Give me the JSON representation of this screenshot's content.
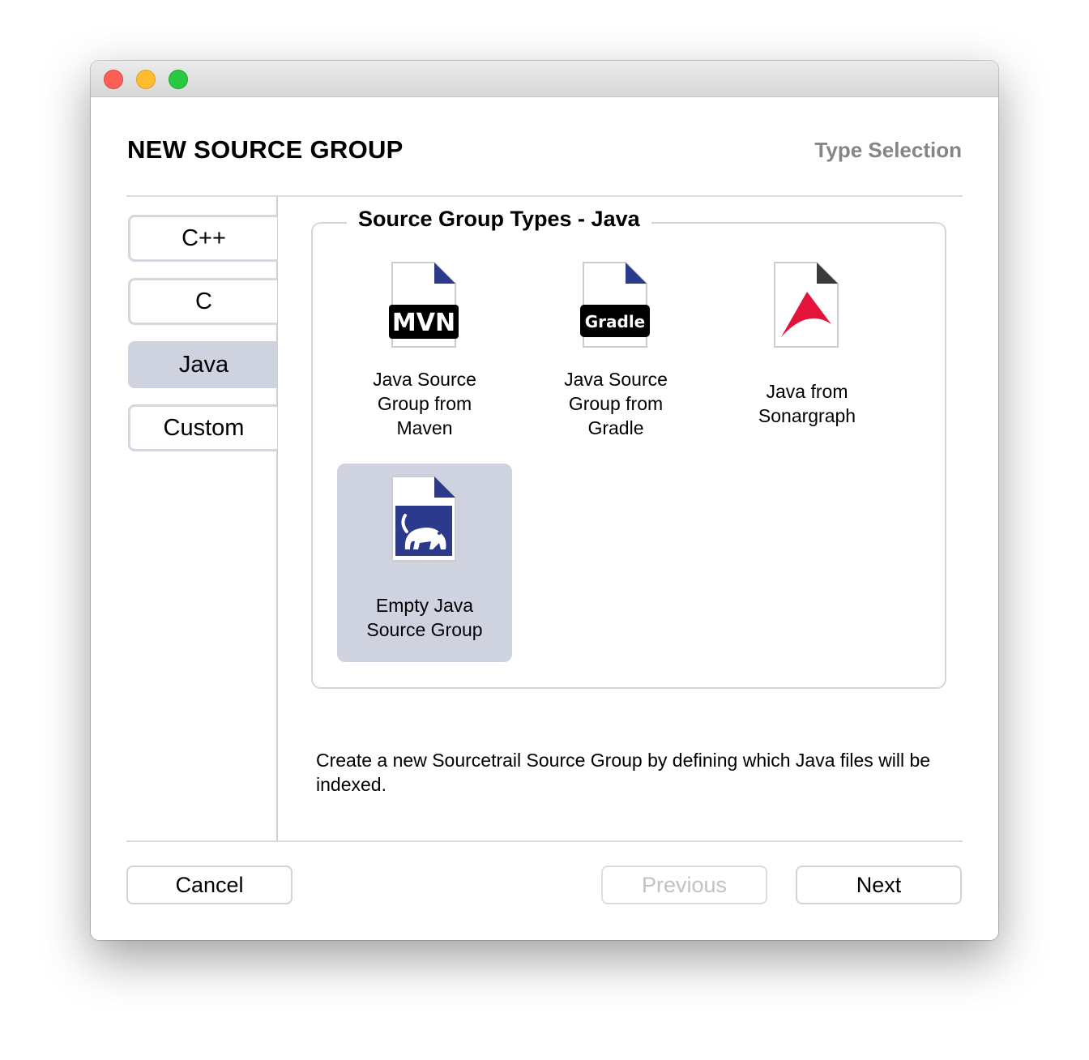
{
  "window": {
    "traffic_lights": [
      "close",
      "minimize",
      "zoom"
    ]
  },
  "header": {
    "title": "NEW SOURCE GROUP",
    "step": "Type Selection"
  },
  "sidebar": {
    "items": [
      {
        "label": "C++",
        "selected": false
      },
      {
        "label": "C",
        "selected": false
      },
      {
        "label": "Java",
        "selected": true
      },
      {
        "label": "Custom",
        "selected": false
      }
    ]
  },
  "types_panel": {
    "title": "Source Group Types - Java",
    "items": [
      {
        "label": "Java Source\nGroup from\nMaven",
        "icon": "maven-file-icon",
        "badge": "MVN",
        "selected": false
      },
      {
        "label": "Java Source\nGroup from\nGradle",
        "icon": "gradle-file-icon",
        "badge": "Gradle",
        "selected": false
      },
      {
        "label": "Java from\nSonargraph",
        "icon": "sonargraph-file-icon",
        "selected": false
      },
      {
        "label": "Empty Java\nSource Group",
        "icon": "sourcetrail-file-icon",
        "selected": true
      }
    ]
  },
  "description": "Create a new Sourcetrail Source Group by defining which Java files will be indexed.",
  "footer": {
    "cancel_label": "Cancel",
    "previous_label": "Previous",
    "next_label": "Next",
    "previous_enabled": false
  },
  "colors": {
    "selection": "#cfd2df",
    "sourcetrail_blue": "#2c3a8c",
    "sonargraph_red": "#e3143c"
  }
}
